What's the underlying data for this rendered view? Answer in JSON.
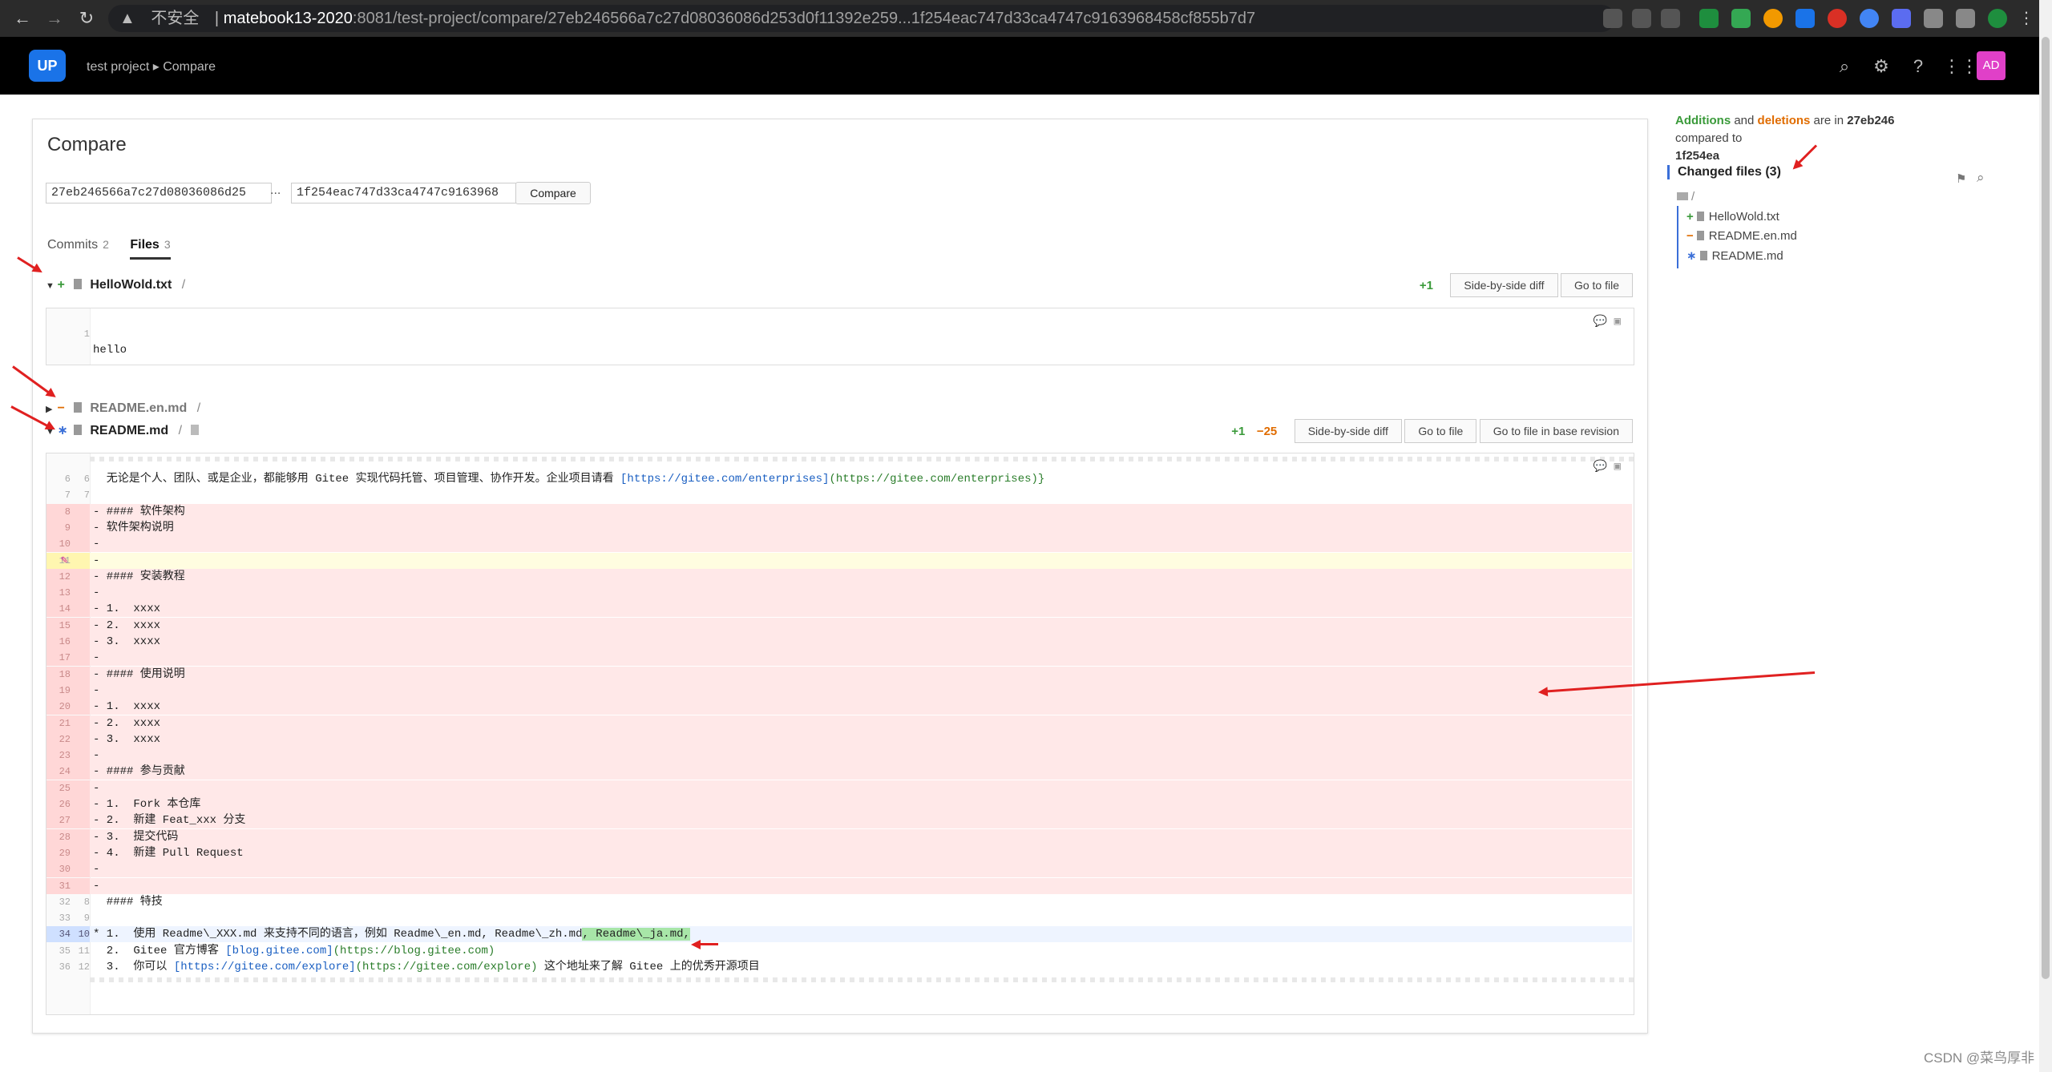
{
  "browser": {
    "insecure_label": "不安全",
    "url_host": "matebook13-2020",
    "url_rest": ":8081/test-project/compare/27eb246566a7c27d08036086d253d0f11392e259...1f254eac747d33ca4747c9163968458cf855b7d7"
  },
  "appbar": {
    "logo_text": "UP",
    "breadcrumb_project": "test project",
    "breadcrumb_sep": "▸",
    "breadcrumb_page": "Compare",
    "avatar_text": "AD"
  },
  "compare": {
    "title": "Compare",
    "base_rev": "27eb246566a7c27d08036086d25",
    "separator": "...",
    "head_rev": "1f254eac747d33ca4747c9163968",
    "compare_button": "Compare"
  },
  "tabs": [
    {
      "label": "Commits",
      "count": "2"
    },
    {
      "label": "Files",
      "count": "3"
    }
  ],
  "files": [
    {
      "name": "HelloWold.txt",
      "status": "+",
      "slash": "/",
      "added": "+1",
      "buttons": [
        "Side-by-side diff",
        "Go to file"
      ]
    },
    {
      "name": "README.en.md",
      "status": "−",
      "slash": "/"
    },
    {
      "name": "README.md",
      "status": "∗",
      "slash": "/",
      "added": "+1",
      "removed": "−25",
      "buttons": [
        "Side-by-side diff",
        "Go to file",
        "Go to file in base revision"
      ]
    }
  ],
  "hello_diff": {
    "ln": "1",
    "text": "hello"
  },
  "readme_diff": [
    {
      "o": "6",
      "n": "6",
      "k": "ctx",
      "t": "  无论是个人、团队、或是企业，都能够用 Gitee 实现代码托管、项目管理、协作开发。企业项目请看 ",
      "l1": "[https://gitee.com/enterprises]",
      "l2": "(https://gitee.com/enterprises)}"
    },
    {
      "o": "7",
      "n": "7",
      "k": "ctx",
      "t": ""
    },
    {
      "o": "8",
      "n": "",
      "k": "del",
      "t": "- #### 软件架构"
    },
    {
      "o": "9",
      "n": "",
      "k": "del",
      "t": "- 软件架构说明"
    },
    {
      "o": "10",
      "n": "",
      "k": "del",
      "t": "-"
    },
    {
      "o": "11",
      "n": "",
      "k": "hl",
      "t": "-"
    },
    {
      "o": "12",
      "n": "",
      "k": "del",
      "t": "- #### 安装教程"
    },
    {
      "o": "13",
      "n": "",
      "k": "del",
      "t": "-"
    },
    {
      "o": "14",
      "n": "",
      "k": "del",
      "t": "- 1.  xxxx"
    },
    {
      "o": "15",
      "n": "",
      "k": "del",
      "t": "- 2.  xxxx"
    },
    {
      "o": "16",
      "n": "",
      "k": "del",
      "t": "- 3.  xxxx"
    },
    {
      "o": "17",
      "n": "",
      "k": "del",
      "t": "-"
    },
    {
      "o": "18",
      "n": "",
      "k": "del",
      "t": "- #### 使用说明"
    },
    {
      "o": "19",
      "n": "",
      "k": "del",
      "t": "-"
    },
    {
      "o": "20",
      "n": "",
      "k": "del",
      "t": "- 1.  xxxx"
    },
    {
      "o": "21",
      "n": "",
      "k": "del",
      "t": "- 2.  xxxx"
    },
    {
      "o": "22",
      "n": "",
      "k": "del",
      "t": "- 3.  xxxx"
    },
    {
      "o": "23",
      "n": "",
      "k": "del",
      "t": "-"
    },
    {
      "o": "24",
      "n": "",
      "k": "del",
      "t": "- #### 参与贡献"
    },
    {
      "o": "25",
      "n": "",
      "k": "del",
      "t": "-"
    },
    {
      "o": "26",
      "n": "",
      "k": "del",
      "t": "- 1.  Fork 本仓库"
    },
    {
      "o": "27",
      "n": "",
      "k": "del",
      "t": "- 2.  新建 Feat_xxx 分支"
    },
    {
      "o": "28",
      "n": "",
      "k": "del",
      "t": "- 3.  提交代码"
    },
    {
      "o": "29",
      "n": "",
      "k": "del",
      "t": "- 4.  新建 Pull Request"
    },
    {
      "o": "30",
      "n": "",
      "k": "del",
      "t": "-"
    },
    {
      "o": "31",
      "n": "",
      "k": "del",
      "t": "-"
    },
    {
      "o": "32",
      "n": "8",
      "k": "ctx",
      "t": "  #### 特技"
    },
    {
      "o": "33",
      "n": "9",
      "k": "ctx",
      "t": ""
    },
    {
      "o": "34",
      "n": "10",
      "k": "mod",
      "t": "* 1.  使用 Readme\\_XXX.md 来支持不同的语言，例如 Readme\\_en.md, Readme\\_zh.md",
      "l1": ", Readme\\_ja.md,"
    },
    {
      "o": "35",
      "n": "11",
      "k": "ctx",
      "t": "  2.  Gitee 官方博客 ",
      "l1": "[blog.gitee.com]",
      "l2": "(https://blog.gitee.com)"
    },
    {
      "o": "36",
      "n": "12",
      "k": "ctx",
      "t": "  3.  你可以 ",
      "l1": "[https://gitee.com/explore]",
      "l2": "(https://gitee.com/explore)",
      "t2": " 这个地址来了解 Gitee 上的优秀开源项目"
    }
  ],
  "sidebar": {
    "additions": "Additions",
    "and": " and ",
    "deletions": "deletions",
    "are_in": " are in ",
    "head": "27eb246",
    "compared_to": " compared to",
    "base": "1f254ea",
    "changed_files": "Changed files (3)",
    "root": "/",
    "items": [
      {
        "status": "+",
        "name": "HelloWold.txt"
      },
      {
        "status": "−",
        "name": "README.en.md"
      },
      {
        "status": "∗",
        "name": "README.md"
      }
    ]
  },
  "watermark": "CSDN @菜鸟厚非",
  "icons": [
    "back-icon",
    "forward-icon",
    "reload-icon",
    "search-icon",
    "settings-icon",
    "help-icon",
    "apps-icon",
    "file-icon",
    "comment-icon",
    "folder-icon",
    "flag-icon"
  ],
  "colors": {
    "added": "#3a9a3a",
    "deleted": "#e06c00",
    "del_bg": "#ffe8e8",
    "accent": "#3a6fd8"
  }
}
